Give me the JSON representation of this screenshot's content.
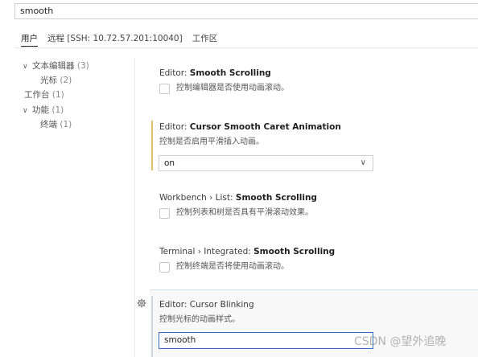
{
  "search": {
    "value": "smooth"
  },
  "tabs": [
    {
      "label": "用户",
      "active": true
    },
    {
      "label": "远程 [SSH: 10.72.57.201:10040]",
      "active": false
    },
    {
      "label": "工作区",
      "active": false
    }
  ],
  "toc": {
    "items": [
      {
        "label": "文本编辑器",
        "count": "(3)",
        "expanded": true,
        "level": 0
      },
      {
        "label": "光标",
        "count": "(2)",
        "level": 1
      },
      {
        "label": "工作台",
        "count": "(1)",
        "level": 0
      },
      {
        "label": "功能",
        "count": "(1)",
        "expanded": true,
        "level": 0
      },
      {
        "label": "终端",
        "count": "(1)",
        "level": 1
      }
    ]
  },
  "settings": [
    {
      "category": "Editor: ",
      "name": "Smooth Scrolling",
      "description": "控制编辑器是否使用动画滚动。",
      "control": "checkbox",
      "checked": false
    },
    {
      "category": "Editor: ",
      "name": "Cursor Smooth Caret Animation",
      "description": "控制是否启用平滑插入动画。",
      "control": "select",
      "value": "on",
      "modified": true
    },
    {
      "category": "Workbench › List: ",
      "name": "Smooth Scrolling",
      "description": "控制列表和树是否具有平滑滚动效果。",
      "control": "checkbox",
      "checked": false
    },
    {
      "category": "Terminal › Integrated: ",
      "name": "Smooth Scrolling",
      "description": "控制终端是否将使用动画滚动。",
      "control": "checkbox",
      "checked": false
    },
    {
      "category": "Editor: ",
      "name": "Cursor Blinking",
      "description": "控制光标的动画样式。",
      "control": "text",
      "value": "smooth",
      "focused": true
    }
  ],
  "watermark": "CSDN @望外追晚",
  "colors": {
    "modified_indicator": "#e2bd6b",
    "focus_border": "#2f6fbf"
  },
  "icons": {
    "toc_expanded": "chevron-down-icon",
    "select_dropdown": "chevron-down-icon",
    "setting_menu": "gear-icon"
  }
}
